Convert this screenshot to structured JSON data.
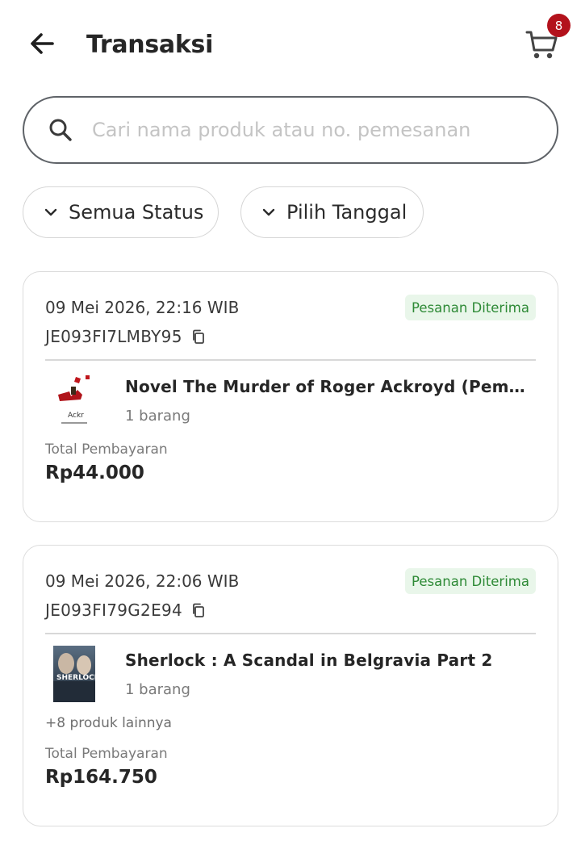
{
  "header": {
    "title": "Transaksi",
    "back_icon": "arrow-left-icon",
    "cart_icon": "cart-icon",
    "cart_count": "8"
  },
  "search": {
    "placeholder": "Cari nama produk atau no. pemesanan",
    "value": ""
  },
  "filters": [
    {
      "label": "Semua Status",
      "icon": "chevron-down-icon"
    },
    {
      "label": "Pilih Tanggal",
      "icon": "chevron-down-icon"
    }
  ],
  "orders": [
    {
      "datetime": "09 Mei 2026, 22:16 WIB",
      "status": "Pesanan Diterima",
      "order_id": "JE093FI7LMBY95",
      "product_name": "Novel The Murder of Roger Ackroyd (Pembunuhan Roger Ackroyd)",
      "quantity": "1 barang",
      "more_products": "",
      "total_label": "Total Pembayaran",
      "total": "Rp44.000"
    },
    {
      "datetime": "09 Mei 2026, 22:06 WIB",
      "status": "Pesanan Diterima",
      "order_id": "JE093FI79G2E94",
      "product_name": "Sherlock : A Scandal in Belgravia Part 2",
      "quantity": "1 barang",
      "more_products": "+8 produk lainnya",
      "total_label": "Total Pembayaran",
      "total": "Rp164.750"
    }
  ],
  "colors": {
    "brand_red": "#b3121c",
    "status_green_text": "#2e8a36",
    "status_green_bg": "#e9f6ea"
  }
}
